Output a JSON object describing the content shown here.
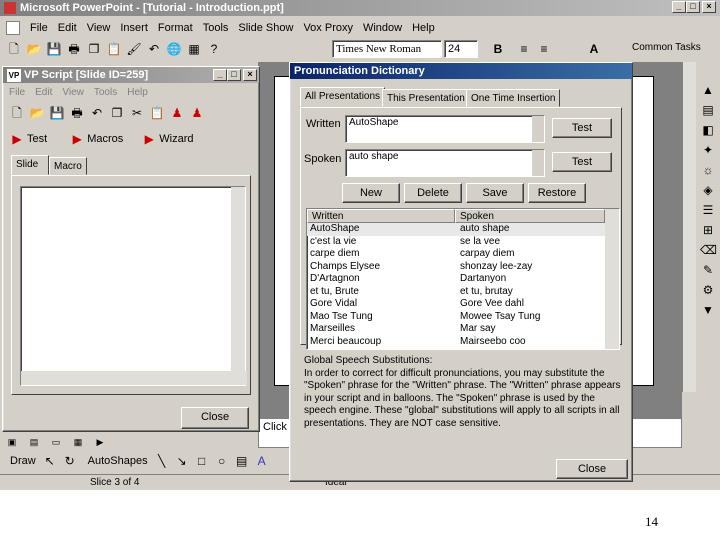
{
  "app": {
    "title": "Microsoft PowerPoint - [Tutorial - Introduction.ppt]",
    "menu": [
      "File",
      "Edit",
      "View",
      "Insert",
      "Format",
      "Tools",
      "Slide Show",
      "Vox Proxy",
      "Window",
      "Help"
    ],
    "font_name": "Times New Roman",
    "font_size": "24",
    "common_tasks": "Common Tasks",
    "status": "Slice 3 of 4",
    "status2": "Ideal",
    "draw_label": "Draw",
    "autoshapes_label": "AutoShapes",
    "slide_click_text": "Click"
  },
  "vp": {
    "title": "VP Script [Slide ID=259]",
    "menu": [
      "File",
      "Edit",
      "View",
      "Tools",
      "Help"
    ],
    "toolbar": {
      "test": "Test",
      "macros": "Macros",
      "wizard": "Wizard"
    },
    "tabs": [
      "Slide",
      "Macro"
    ],
    "close": "Close"
  },
  "dict": {
    "title": "Pronunciation Dictionary",
    "tabs": [
      "All Presentations",
      "This Presentation",
      "One Time Insertion"
    ],
    "written_label": "Written",
    "written_value": "AutoShape",
    "spoken_label": "Spoken",
    "spoken_value": "auto shape",
    "test1": "Test",
    "test2": "Test",
    "buttons": {
      "new": "New",
      "delete": "Delete",
      "save": "Save",
      "restore": "Restore"
    },
    "columns": [
      "Written",
      "Spoken"
    ],
    "rows": [
      [
        "AutoShape",
        "auto shape"
      ],
      [
        "c'est la vie",
        "se la vee"
      ],
      [
        "carpe diem",
        "carpay diem"
      ],
      [
        "Champs Elysee",
        "shonzay lee-zay"
      ],
      [
        "D'Artagnon",
        "Dartanyon"
      ],
      [
        "et tu, Brute",
        "et tu, brutay"
      ],
      [
        "Gore Vidal",
        "Gore Vee dahl"
      ],
      [
        "Mao Tse Tung",
        "Mowee Tsay Tung"
      ],
      [
        "Marseilles",
        "Mar say"
      ],
      [
        "Merci beaucoup",
        "Mairseebo coo"
      ]
    ],
    "info_title": "Global Speech Substitutions:",
    "info_text": "In order to correct for difficult pronunciations, you may substitute the \"Spoken\" phrase for the \"Written\" phrase. The \"Written\" phrase appears in your script and in balloons. The \"Spoken\" phrase is used by the speech engine. These \"global\" substitutions will apply to all scripts in all presentations. They are NOT case sensitive.",
    "close": "Close"
  },
  "page_number": "14",
  "colors": {
    "face": "#d4d0c8",
    "title": "#0a246a",
    "selection": "#e8e8e8"
  }
}
